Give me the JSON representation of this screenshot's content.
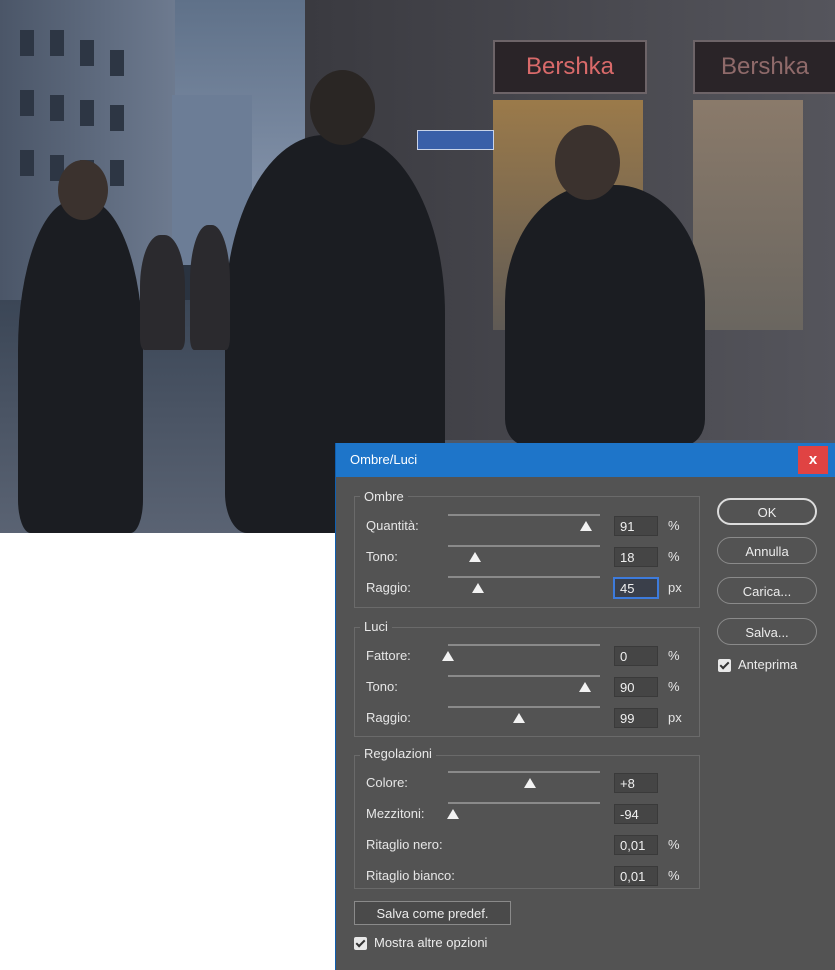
{
  "photo": {
    "sign_left": "Bershka",
    "sign_right": "Bershka"
  },
  "dialog": {
    "title": "Ombre/Luci",
    "close_label": "x",
    "groups": {
      "ombre": {
        "legend": "Ombre",
        "rows": [
          {
            "label": "Quantità:",
            "value": "91",
            "unit": "%",
            "level": 0.91
          },
          {
            "label": "Tono:",
            "value": "18",
            "unit": "%",
            "level": 0.18
          },
          {
            "label": "Raggio:",
            "value": "45",
            "unit": "px",
            "level": 0.2
          }
        ]
      },
      "luci": {
        "legend": "Luci",
        "rows": [
          {
            "label": "Fattore:",
            "value": "0",
            "unit": "%",
            "level": 0.0
          },
          {
            "label": "Tono:",
            "value": "90",
            "unit": "%",
            "level": 0.9
          },
          {
            "label": "Raggio:",
            "value": "99",
            "unit": "px",
            "level": 0.47
          }
        ]
      },
      "regolazioni": {
        "legend": "Regolazioni",
        "rows": [
          {
            "label": "Colore:",
            "value": "+8",
            "unit": "",
            "level": 0.54
          },
          {
            "label": "Mezzitoni:",
            "value": "-94",
            "unit": "",
            "level": 0.03
          },
          {
            "label": "Ritaglio nero:",
            "value": "0,01",
            "unit": "%"
          },
          {
            "label": "Ritaglio bianco:",
            "value": "0,01",
            "unit": "%"
          }
        ]
      }
    },
    "buttons": {
      "ok": "OK",
      "cancel": "Annulla",
      "load": "Carica...",
      "save": "Salva..."
    },
    "preview": {
      "label": "Anteprima",
      "checked": true
    },
    "save_default": "Salva come predef.",
    "more_options": {
      "label": "Mostra altre opzioni",
      "checked": true
    }
  }
}
